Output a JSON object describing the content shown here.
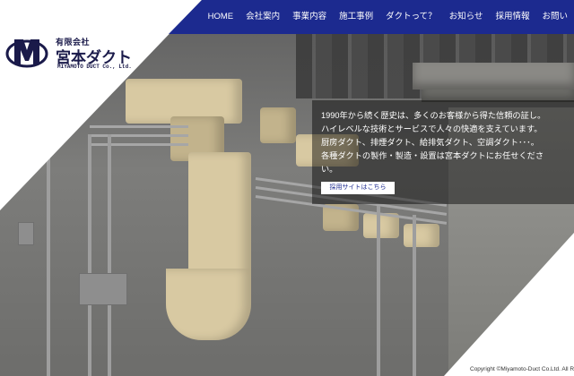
{
  "logo": {
    "small_text": "有限会社",
    "company_name": "宮本ダクト",
    "english_name": "MIYAMOTO DUCT Co., Ltd."
  },
  "nav": {
    "items": [
      {
        "label": "HOME"
      },
      {
        "label": "会社案内"
      },
      {
        "label": "事業内容"
      },
      {
        "label": "施工事例"
      },
      {
        "label": "ダクトって？"
      },
      {
        "label": "お知らせ"
      },
      {
        "label": "採用情報"
      },
      {
        "label": "お問い"
      }
    ]
  },
  "hero": {
    "lines": [
      "1990年から続く歴史は、多くのお客様から得た信頼の証し。",
      "ハイレベルな技術とサービスで人々の快適を支えています。",
      "厨房ダクト、排煙ダクト、給排気ダクト、空調ダクト･･･。",
      "各種ダクトの製作・製造・設置は宮本ダクトにお任せくださ",
      "い。"
    ],
    "recruit_button": "採用サイトはこちら"
  },
  "footer": {
    "copyright": "Copyright ©Miyamoto-Duct Co.Ltd. All Rig"
  },
  "colors": {
    "nav_bar": "#1c2a8f",
    "logo_navy": "#1a1a4a",
    "panel_overlay": "rgba(0,0,0,0.45)"
  }
}
